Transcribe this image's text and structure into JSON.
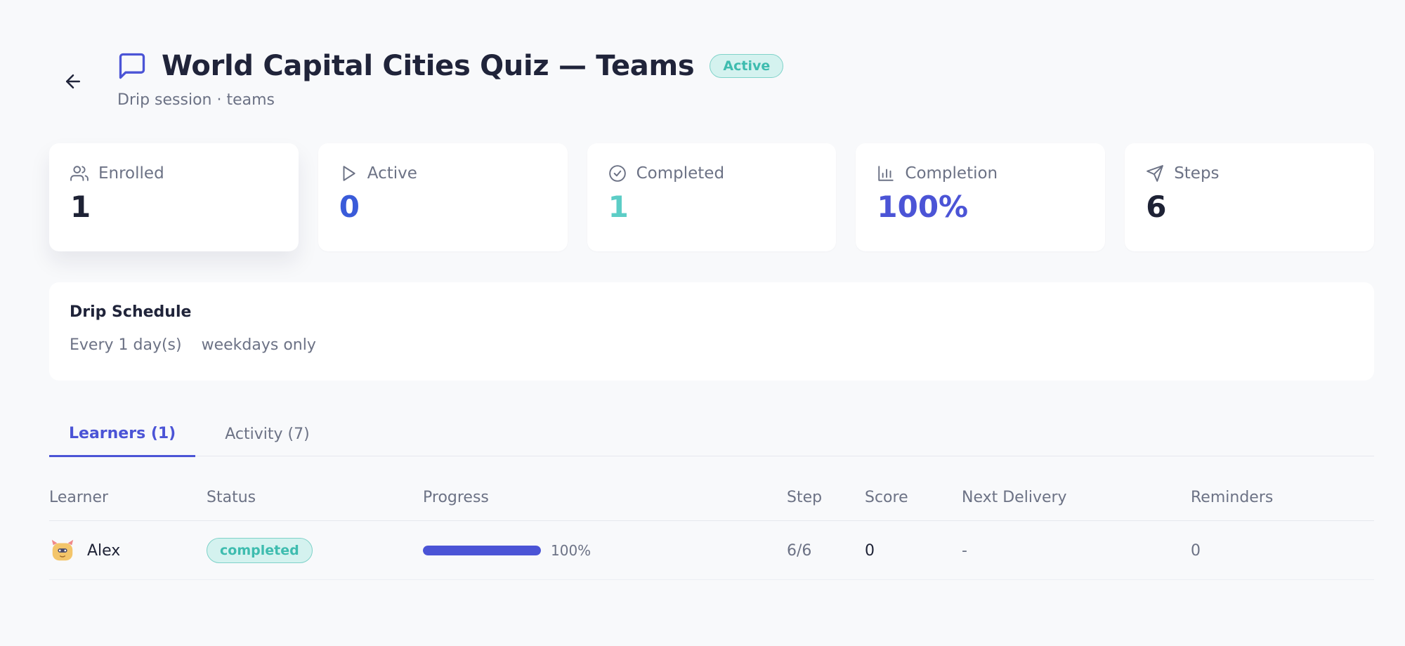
{
  "header": {
    "title": "World Capital Cities Quiz — Teams",
    "status": "Active",
    "subtitle": "Drip session · teams"
  },
  "stats": [
    {
      "label": "Enrolled",
      "value": "1",
      "icon": "users-icon",
      "color": "#1e2235"
    },
    {
      "label": "Active",
      "value": "0",
      "icon": "play-icon",
      "color": "#3a5bd9"
    },
    {
      "label": "Completed",
      "value": "1",
      "icon": "check-circle-icon",
      "color": "#5ccdc6"
    },
    {
      "label": "Completion",
      "value": "100%",
      "icon": "bar-chart-icon",
      "color": "#4b54d6"
    },
    {
      "label": "Steps",
      "value": "6",
      "icon": "send-icon",
      "color": "#1e2235"
    }
  ],
  "schedule": {
    "title": "Drip Schedule",
    "frequency": "Every 1 day(s)",
    "constraint": "weekdays only"
  },
  "tabs": [
    {
      "label": "Learners (1)",
      "active": true
    },
    {
      "label": "Activity (7)",
      "active": false
    }
  ],
  "table": {
    "columns": [
      "Learner",
      "Status",
      "Progress",
      "Step",
      "Score",
      "Next Delivery",
      "Reminders"
    ],
    "rows": [
      {
        "learner": "Alex",
        "status": "completed",
        "progress_percent": 100,
        "progress_label": "100%",
        "step": "6/6",
        "score": "0",
        "next_delivery": "-",
        "reminders": "0"
      }
    ]
  },
  "colors": {
    "accent": "#4b54d6",
    "success": "#3ebcaf",
    "success_bg": "#d4f2ef"
  }
}
